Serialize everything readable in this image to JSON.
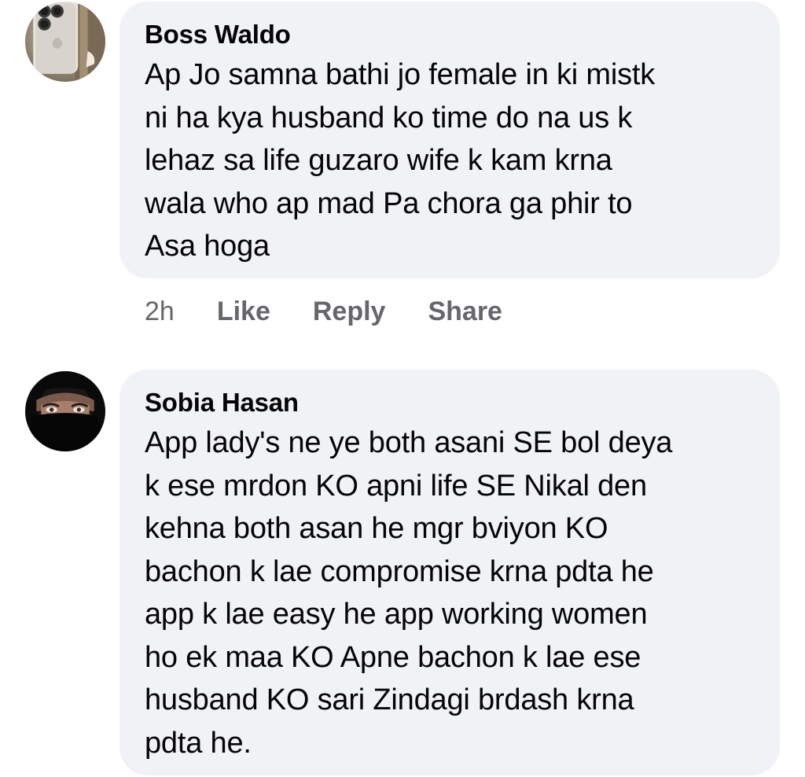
{
  "comments": [
    {
      "author": "Boss Waldo",
      "text": "Ap Jo samna bathi jo female in ki mistk\nni ha kya husband ko time do na us k\nlehaz sa life guzaro wife k kam krna\nwala who ap mad Pa chora ga phir to\nAsa hoga",
      "avatar_icon": "phone-avatar-icon",
      "time": "2h",
      "actions": {
        "like": "Like",
        "reply": "Reply",
        "share": "Share"
      }
    },
    {
      "author": "Sobia Hasan",
      "text": "App lady's ne ye both asani SE bol deya\nk ese mrdon KO apni life SE Nikal den\nkehna both asan he mgr  bviyon KO\nbachon k lae compromise krna pdta he\napp k lae easy he app working women\nho ek maa KO Apne bachon k lae ese\nhusband KO sari Zindagi brdash krna\npdta he.",
      "avatar_icon": "veiled-woman-avatar-icon"
    }
  ],
  "colors": {
    "bubble": "#f0f2f5",
    "text": "#050505",
    "secondary_text": "#65676b"
  }
}
